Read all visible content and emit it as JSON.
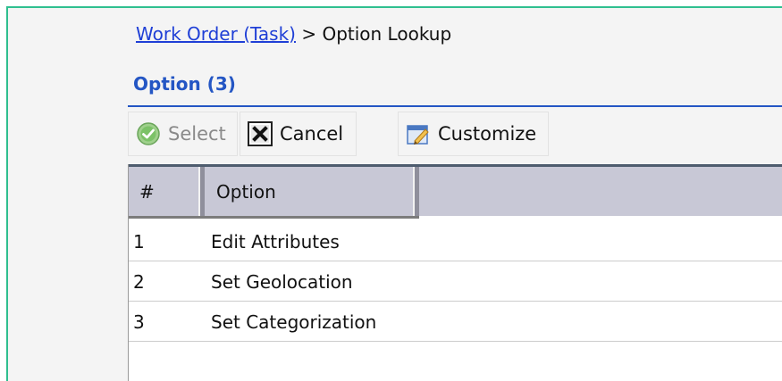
{
  "breadcrumb": {
    "link": "Work Order (Task)",
    "separator": " > ",
    "current": "Option Lookup"
  },
  "section": {
    "title": "Option (3)"
  },
  "toolbar": {
    "select_label": "Select",
    "cancel_label": "Cancel",
    "customize_label": "Customize"
  },
  "grid": {
    "columns": [
      "#",
      "Option"
    ],
    "rows": [
      {
        "num": "1",
        "option": "Edit Attributes"
      },
      {
        "num": "2",
        "option": "Set Geolocation"
      },
      {
        "num": "3",
        "option": "Set Categorization"
      }
    ]
  },
  "colors": {
    "frame_border": "#2fbf8f",
    "title_blue": "#2456c4",
    "link_blue": "#1f3fd6",
    "header_bg": "#c8c8d6"
  },
  "icons": {
    "select": "check-circle-icon",
    "cancel": "close-box-icon",
    "customize": "edit-window-icon"
  }
}
